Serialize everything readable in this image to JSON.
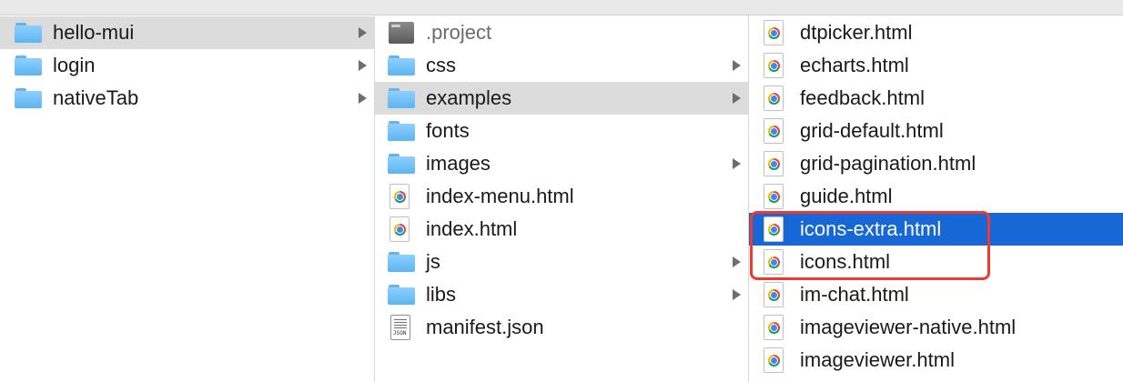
{
  "columns": [
    {
      "items": [
        {
          "label": "hello-mui",
          "icon": "folder-icon",
          "has_children": true,
          "state": "selected-inactive"
        },
        {
          "label": "login",
          "icon": "folder-icon",
          "has_children": true,
          "state": "none"
        },
        {
          "label": "nativeTab",
          "icon": "folder-icon",
          "has_children": true,
          "state": "none"
        }
      ]
    },
    {
      "items": [
        {
          "label": ".project",
          "icon": "project-file-icon",
          "has_children": false,
          "state": "dimmed"
        },
        {
          "label": "css",
          "icon": "folder-icon",
          "has_children": true,
          "state": "none"
        },
        {
          "label": "examples",
          "icon": "folder-icon",
          "has_children": true,
          "state": "selected-inactive"
        },
        {
          "label": "fonts",
          "icon": "folder-icon",
          "has_children": false,
          "state": "none"
        },
        {
          "label": "images",
          "icon": "folder-icon",
          "has_children": true,
          "state": "none"
        },
        {
          "label": "index-menu.html",
          "icon": "chrome-html-icon",
          "has_children": false,
          "state": "none"
        },
        {
          "label": "index.html",
          "icon": "chrome-html-icon",
          "has_children": false,
          "state": "none"
        },
        {
          "label": "js",
          "icon": "folder-icon",
          "has_children": true,
          "state": "none"
        },
        {
          "label": "libs",
          "icon": "folder-icon",
          "has_children": true,
          "state": "none"
        },
        {
          "label": "manifest.json",
          "icon": "json-file-icon",
          "has_children": false,
          "state": "none"
        }
      ]
    },
    {
      "items": [
        {
          "label": "dtpicker.html",
          "icon": "chrome-html-icon",
          "has_children": false,
          "state": "none"
        },
        {
          "label": "echarts.html",
          "icon": "chrome-html-icon",
          "has_children": false,
          "state": "none"
        },
        {
          "label": "feedback.html",
          "icon": "chrome-html-icon",
          "has_children": false,
          "state": "none"
        },
        {
          "label": "grid-default.html",
          "icon": "chrome-html-icon",
          "has_children": false,
          "state": "none"
        },
        {
          "label": "grid-pagination.html",
          "icon": "chrome-html-icon",
          "has_children": false,
          "state": "none"
        },
        {
          "label": "guide.html",
          "icon": "chrome-html-icon",
          "has_children": false,
          "state": "none"
        },
        {
          "label": "icons-extra.html",
          "icon": "chrome-html-icon",
          "has_children": false,
          "state": "selected-active"
        },
        {
          "label": "icons.html",
          "icon": "chrome-html-icon",
          "has_children": false,
          "state": "none"
        },
        {
          "label": "im-chat.html",
          "icon": "chrome-html-icon",
          "has_children": false,
          "state": "none"
        },
        {
          "label": "imageviewer-native.html",
          "icon": "chrome-html-icon",
          "has_children": false,
          "state": "none"
        },
        {
          "label": "imageviewer.html",
          "icon": "chrome-html-icon",
          "has_children": false,
          "state": "none"
        }
      ]
    }
  ],
  "colors": {
    "active_selection": "#1768d6",
    "inactive_selection": "#dcdcdc",
    "annotation_box": "#f0382e",
    "folder": "#5cb5f2"
  },
  "annotation": {
    "type": "highlight-box",
    "wraps": [
      "icons-extra.html",
      "icons.html"
    ]
  }
}
